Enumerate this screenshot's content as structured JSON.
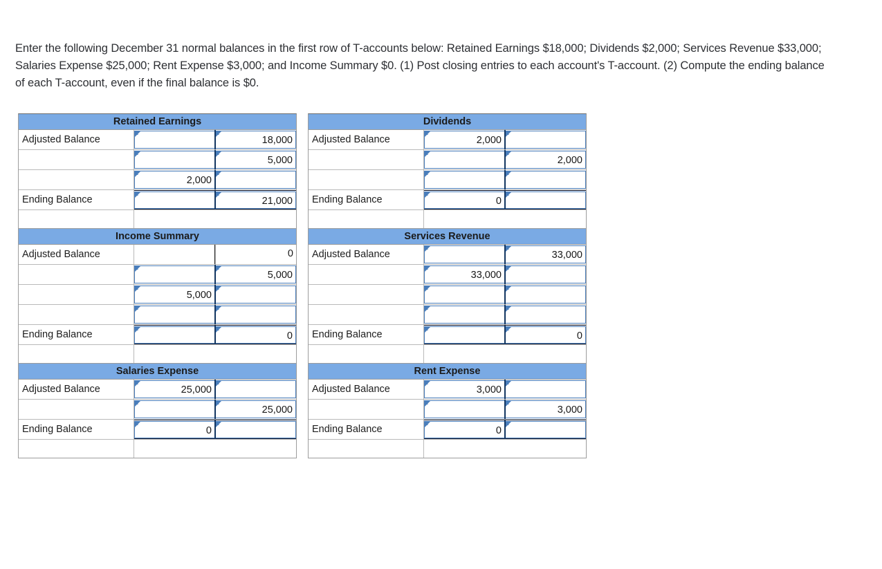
{
  "instructions": "Enter the following December 31 normal balances in the first row of T-accounts below: Retained Earnings $18,000; Dividends $2,000; Services Revenue $33,000; Salaries Expense $25,000; Rent Expense $3,000; and Income Summary $0. (1) Post closing entries to each account's T-account. (2) Compute the ending balance of each T-account, even if the final balance is $0.",
  "colors": {
    "header_blue": "#7aaae4",
    "input_border_blue": "#4a7ebb",
    "grid_gray": "#b9b9b9",
    "text": "#1d1d1d"
  },
  "labels": {
    "adjusted_balance": "Adjusted Balance",
    "ending_balance": "Ending Balance",
    "blank": ""
  },
  "accounts": [
    {
      "id": "retained-earnings",
      "title": "Retained Earnings",
      "column": "left",
      "rows": [
        {
          "label": "Adjusted Balance",
          "debit": "",
          "credit": "18,000",
          "type": "input",
          "ending": false
        },
        {
          "label": "",
          "debit": "",
          "credit": "5,000",
          "type": "input",
          "ending": false
        },
        {
          "label": "",
          "debit": "2,000",
          "credit": "",
          "type": "input",
          "ending": false
        },
        {
          "label": "Ending Balance",
          "debit": "",
          "credit": "21,000",
          "type": "input",
          "ending": true
        }
      ]
    },
    {
      "id": "income-summary",
      "title": "Income Summary",
      "column": "left",
      "rows": [
        {
          "label": "Adjusted Balance",
          "debit": "",
          "credit": "0",
          "type": "plain",
          "ending": false
        },
        {
          "label": "",
          "debit": "",
          "credit": "5,000",
          "type": "input",
          "ending": false
        },
        {
          "label": "",
          "debit": "5,000",
          "credit": "",
          "type": "input",
          "ending": false
        },
        {
          "label": "",
          "debit": "",
          "credit": "",
          "type": "input",
          "ending": false
        },
        {
          "label": "Ending Balance",
          "debit": "",
          "credit": "0",
          "type": "input",
          "ending": true
        }
      ]
    },
    {
      "id": "salaries-expense",
      "title": "Salaries Expense",
      "column": "left",
      "rows": [
        {
          "label": "Adjusted Balance",
          "debit": "25,000",
          "credit": "",
          "type": "input",
          "ending": false
        },
        {
          "label": "",
          "debit": "",
          "credit": "25,000",
          "type": "input",
          "ending": false
        },
        {
          "label": "Ending Balance",
          "debit": "0",
          "credit": "",
          "type": "input",
          "ending": true
        }
      ]
    },
    {
      "id": "dividends",
      "title": "Dividends",
      "column": "right",
      "rows": [
        {
          "label": "Adjusted Balance",
          "debit": "2,000",
          "credit": "",
          "type": "input",
          "ending": false
        },
        {
          "label": "",
          "debit": "",
          "credit": "2,000",
          "type": "input",
          "ending": false
        },
        {
          "label": "",
          "debit": "",
          "credit": "",
          "type": "input",
          "ending": false
        },
        {
          "label": "Ending Balance",
          "debit": "0",
          "credit": "",
          "type": "input",
          "ending": true
        }
      ]
    },
    {
      "id": "services-revenue",
      "title": "Services Revenue",
      "column": "right",
      "rows": [
        {
          "label": "Adjusted Balance",
          "debit": "",
          "credit": "33,000",
          "type": "input",
          "ending": false
        },
        {
          "label": "",
          "debit": "33,000",
          "credit": "",
          "type": "input",
          "ending": false
        },
        {
          "label": "",
          "debit": "",
          "credit": "",
          "type": "input",
          "ending": false
        },
        {
          "label": "",
          "debit": "",
          "credit": "",
          "type": "input",
          "ending": false
        },
        {
          "label": "Ending Balance",
          "debit": "",
          "credit": "0",
          "type": "input",
          "ending": true
        }
      ]
    },
    {
      "id": "rent-expense",
      "title": "Rent Expense",
      "column": "right",
      "rows": [
        {
          "label": "Adjusted Balance",
          "debit": "3,000",
          "credit": "",
          "type": "input",
          "ending": false
        },
        {
          "label": "",
          "debit": "",
          "credit": "3,000",
          "type": "input",
          "ending": false
        },
        {
          "label": "Ending Balance",
          "debit": "0",
          "credit": "",
          "type": "input",
          "ending": true
        }
      ]
    }
  ]
}
